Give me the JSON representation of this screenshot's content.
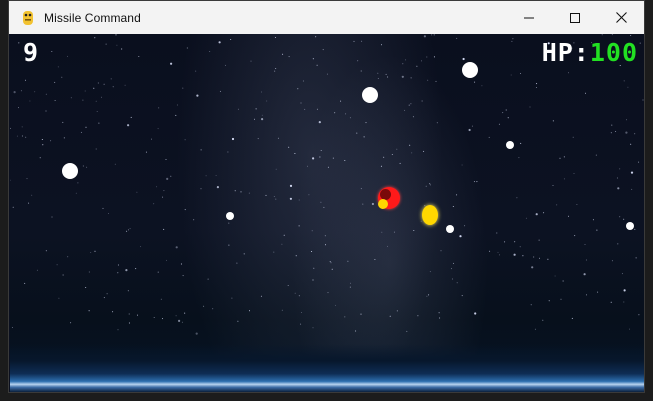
{
  "window": {
    "title": "Missile Command",
    "icon": "python-snake-icon",
    "controls": [
      "minimize-icon",
      "maximize-icon",
      "close-icon"
    ]
  },
  "hud": {
    "score": "9",
    "hp_label": "HP:",
    "hp_value": "100",
    "hp_color": "#22e022"
  },
  "scene": {
    "background": "starry night sky with milky way and earth horizon",
    "missile_color": "#ffffff",
    "explosion_colors": [
      "#ff1a1a",
      "#ffd700"
    ]
  }
}
